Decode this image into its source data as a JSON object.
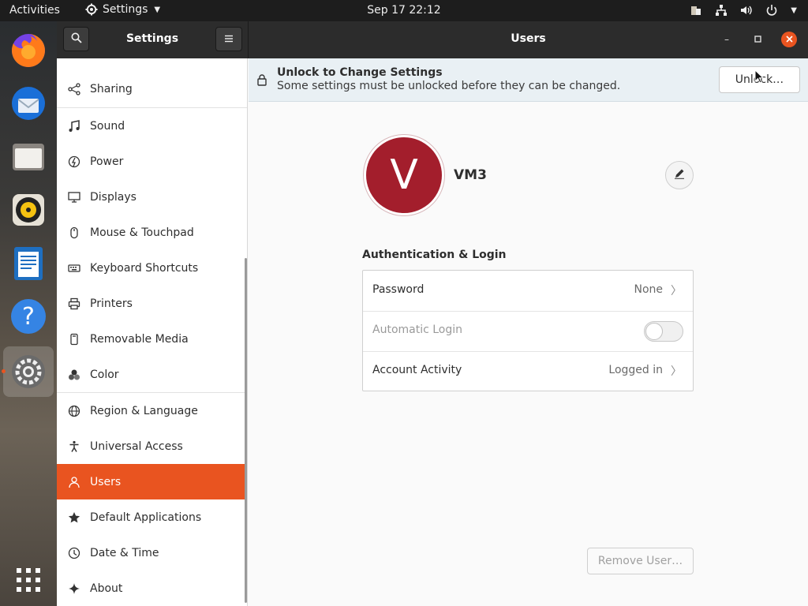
{
  "topbar": {
    "activities": "Activities",
    "app_menu": "Settings",
    "clock": "Sep 17  22:12"
  },
  "dock": {
    "items": [
      {
        "name": "firefox-icon"
      },
      {
        "name": "thunderbird-icon"
      },
      {
        "name": "files-icon"
      },
      {
        "name": "rhythmbox-icon"
      },
      {
        "name": "libreoffice-writer-icon"
      },
      {
        "name": "help-icon"
      },
      {
        "name": "settings-icon",
        "active": true
      },
      {
        "name": "show-applications-icon"
      }
    ]
  },
  "window": {
    "sidebar_title": "Settings",
    "title": "Users"
  },
  "sidebar": {
    "items": [
      {
        "label": "Sharing",
        "icon": "share-icon"
      },
      {
        "label": "Sound",
        "icon": "music-note-icon"
      },
      {
        "label": "Power",
        "icon": "power-icon"
      },
      {
        "label": "Displays",
        "icon": "display-icon"
      },
      {
        "label": "Mouse & Touchpad",
        "icon": "mouse-icon"
      },
      {
        "label": "Keyboard Shortcuts",
        "icon": "keyboard-icon"
      },
      {
        "label": "Printers",
        "icon": "printer-icon"
      },
      {
        "label": "Removable Media",
        "icon": "removable-media-icon"
      },
      {
        "label": "Color",
        "icon": "color-icon"
      },
      {
        "label": "Region & Language",
        "icon": "globe-icon"
      },
      {
        "label": "Universal Access",
        "icon": "accessibility-icon"
      },
      {
        "label": "Users",
        "icon": "user-icon",
        "selected": true
      },
      {
        "label": "Default Applications",
        "icon": "star-icon"
      },
      {
        "label": "Date & Time",
        "icon": "clock-icon"
      },
      {
        "label": "About",
        "icon": "sparkle-icon"
      }
    ]
  },
  "infobar": {
    "title": "Unlock to Change Settings",
    "message": "Some settings must be unlocked before they can be changed.",
    "unlock_label": "Unlock…"
  },
  "user": {
    "avatar_letter": "V",
    "name": "VM3"
  },
  "auth": {
    "section_title": "Authentication & Login",
    "password_label": "Password",
    "password_value": "None",
    "autologin_label": "Automatic Login",
    "autologin_enabled": false,
    "activity_label": "Account Activity",
    "activity_value": "Logged in"
  },
  "remove_user_label": "Remove User…",
  "colors": {
    "accent": "#e95420",
    "avatar_bg": "#a31e2c",
    "topbar_bg": "#1d1d1d",
    "headerbar_bg": "#2c2c2c"
  }
}
